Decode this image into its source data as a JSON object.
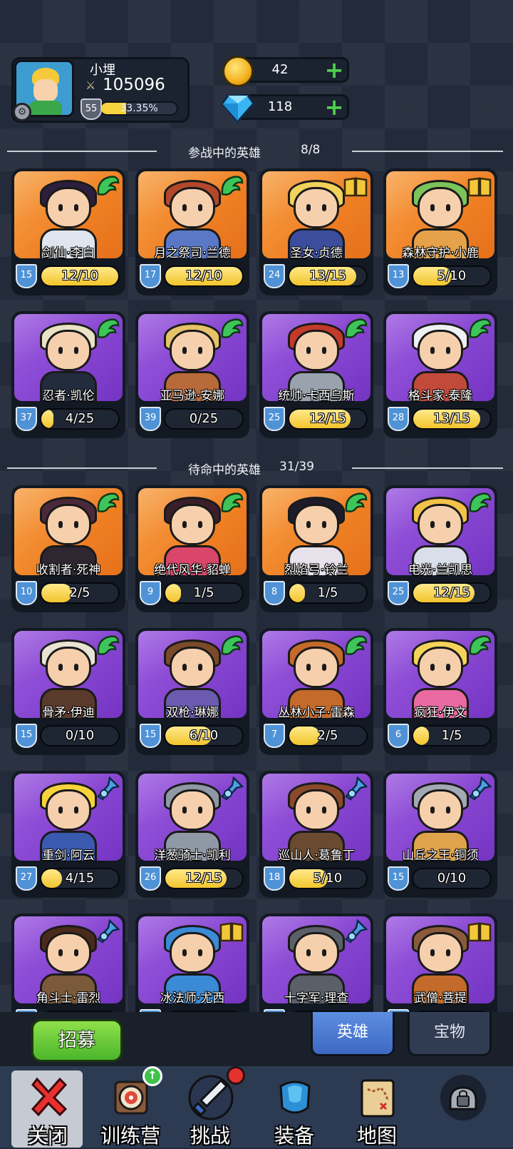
{
  "player": {
    "name": "小埋",
    "power": "105096",
    "level": "55",
    "exp_percent_text": "33.35%",
    "exp_fraction": 0.3335
  },
  "resources": {
    "gold": "42",
    "diamond": "118"
  },
  "sections": {
    "active": {
      "label": "参战中的英雄",
      "count": "8/8"
    },
    "standby": {
      "label": "待命中的英雄",
      "count": "31/39"
    }
  },
  "active_heroes": [
    {
      "name": "剑仙·李白",
      "level": "15",
      "progress": "12/10",
      "fill": 1.0,
      "rarity": "orange",
      "role": "wing",
      "hair": "#2b1f3d",
      "body": "#dfe5ee"
    },
    {
      "name": "月之祭司·兰德",
      "level": "17",
      "progress": "12/10",
      "fill": 1.0,
      "rarity": "orange",
      "role": "wing",
      "hair": "#b3472b",
      "body": "#5a78c6"
    },
    {
      "name": "圣女·贞德",
      "level": "24",
      "progress": "13/15",
      "fill": 0.87,
      "rarity": "orange",
      "role": "book",
      "hair": "#f1d35b",
      "body": "#3b4d9c"
    },
    {
      "name": "森林守护·小鹿",
      "level": "13",
      "progress": "5/10",
      "fill": 0.5,
      "rarity": "orange",
      "role": "book",
      "hair": "#7bc45a",
      "body": "#e6a24a"
    },
    {
      "name": "忍者·凯伦",
      "level": "37",
      "progress": "4/25",
      "fill": 0.16,
      "rarity": "purple",
      "role": "wing",
      "hair": "#e9e2c5",
      "body": "#232c3d"
    },
    {
      "name": "亚马逊·安娜",
      "level": "39",
      "progress": "0/25",
      "fill": 0.0,
      "rarity": "purple",
      "role": "wing",
      "hair": "#e6c268",
      "body": "#b86a3a"
    },
    {
      "name": "统帅·卡西乌斯",
      "level": "25",
      "progress": "12/15",
      "fill": 0.8,
      "rarity": "purple",
      "role": "wing",
      "hair": "#c43a2a",
      "body": "#9aa3ad"
    },
    {
      "name": "格斗家·泰隆",
      "level": "28",
      "progress": "13/15",
      "fill": 0.87,
      "rarity": "purple",
      "role": "wing",
      "hair": "#eef0f3",
      "body": "#c24a3a"
    }
  ],
  "standby_heroes": [
    {
      "name": "收割者·死神",
      "level": "10",
      "progress": "2/5",
      "fill": 0.4,
      "rarity": "orange",
      "role": "wing",
      "hair": "#4a2a3a",
      "body": "#2e2630"
    },
    {
      "name": "绝代风华·貂蝉",
      "level": "9",
      "progress": "1/5",
      "fill": 0.2,
      "rarity": "orange",
      "role": "wing",
      "hair": "#3a1f2a",
      "body": "#d9466a"
    },
    {
      "name": "烈焰弓·铃兰",
      "level": "8",
      "progress": "1/5",
      "fill": 0.2,
      "rarity": "orange",
      "role": "wing",
      "hair": "#1e1b2a",
      "body": "#e6e1ea"
    },
    {
      "name": "电光·兰凯思",
      "level": "25",
      "progress": "12/15",
      "fill": 0.8,
      "rarity": "purple",
      "role": "wing",
      "hair": "#f3c24a",
      "body": "#d9dfe8"
    },
    {
      "name": "骨矛·伊迪",
      "level": "15",
      "progress": "0/10",
      "fill": 0.0,
      "rarity": "purple",
      "role": "wing",
      "hair": "#e9e3d4",
      "body": "#5a3a2a"
    },
    {
      "name": "双枪·琳娜",
      "level": "15",
      "progress": "6/10",
      "fill": 0.6,
      "rarity": "purple",
      "role": "wing",
      "hair": "#7a4a2a",
      "body": "#6a5ab0"
    },
    {
      "name": "丛林小子·雷森",
      "level": "7",
      "progress": "2/5",
      "fill": 0.4,
      "rarity": "purple",
      "role": "wing",
      "hair": "#c46a2a",
      "body": "#c46a2a"
    },
    {
      "name": "疯狂·伊文",
      "level": "6",
      "progress": "1/5",
      "fill": 0.2,
      "rarity": "purple",
      "role": "wing",
      "hair": "#f3d35a",
      "body": "#e86aa0"
    },
    {
      "name": "重剑·阿云",
      "level": "27",
      "progress": "4/15",
      "fill": 0.27,
      "rarity": "purple",
      "role": "potion",
      "hair": "#f6d33a",
      "body": "#3a5ab0"
    },
    {
      "name": "洋葱骑士·凯利",
      "level": "26",
      "progress": "12/15",
      "fill": 0.8,
      "rarity": "purple",
      "role": "potion",
      "hair": "#8f98a5",
      "body": "#8f98a5"
    },
    {
      "name": "巡山人·葛鲁丁",
      "level": "18",
      "progress": "5/10",
      "fill": 0.5,
      "rarity": "purple",
      "role": "potion",
      "hair": "#8a4a2a",
      "body": "#6a4a30"
    },
    {
      "name": "山丘之王·铜须",
      "level": "15",
      "progress": "0/10",
      "fill": 0.0,
      "rarity": "purple",
      "role": "potion",
      "hair": "#a3a9b3",
      "body": "#e0a24a"
    },
    {
      "name": "角斗士·雷烈",
      "level": "",
      "progress": "",
      "fill": 0.0,
      "rarity": "purple",
      "role": "potion",
      "hair": "#4a2a1a",
      "body": "#7a5a3a"
    },
    {
      "name": "冰法师·尤西",
      "level": "",
      "progress": "",
      "fill": 0.0,
      "rarity": "purple",
      "role": "book",
      "hair": "#3a8ad6",
      "body": "#3a8ad6"
    },
    {
      "name": "十字军·理查",
      "level": "",
      "progress": "",
      "fill": 0.0,
      "rarity": "purple",
      "role": "potion",
      "hair": "#5a5f68",
      "body": "#5a5f68"
    },
    {
      "name": "武僧·菩提",
      "level": "",
      "progress": "",
      "fill": 0.0,
      "rarity": "purple",
      "role": "book",
      "hair": "#8a5a3a",
      "body": "#c46a2a"
    }
  ],
  "actions": {
    "recruit": "招募",
    "tab_heroes": "英雄",
    "tab_treasure": "宝物"
  },
  "nav": [
    {
      "id": "close",
      "label": "关闭",
      "icon": "close-icon"
    },
    {
      "id": "training",
      "label": "训练营",
      "icon": "target-icon"
    },
    {
      "id": "challenge",
      "label": "挑战",
      "icon": "sword-icon"
    },
    {
      "id": "equipment",
      "label": "装备",
      "icon": "armor-icon"
    },
    {
      "id": "map",
      "label": "地图",
      "icon": "map-icon"
    },
    {
      "id": "locked",
      "label": "",
      "icon": "lock-icon"
    }
  ],
  "colors": {
    "orange_card": "#ef7f23",
    "purple_card": "#8443cf",
    "wing_role": "#3ec55a",
    "book_role": "#f3c73a",
    "potion_role": "#4f9ee6"
  }
}
